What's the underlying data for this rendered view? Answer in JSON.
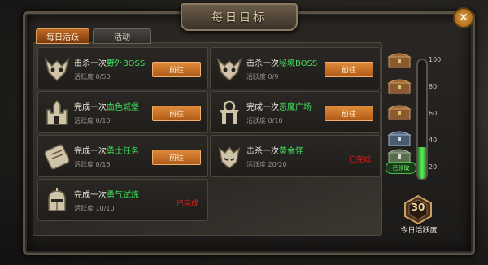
{
  "window": {
    "title": "每日目标"
  },
  "tabs": [
    {
      "label": "每日活跃",
      "active": true
    },
    {
      "label": "活动",
      "active": false
    }
  ],
  "tasks": [
    {
      "prefix": "击杀一次",
      "target": "野外BOSS",
      "progress": "活跃度 0/50",
      "action": "前往",
      "status": "open"
    },
    {
      "prefix": "击杀一次",
      "target": "秘境BOSS",
      "progress": "活跃度 0/9",
      "action": "前往",
      "status": "open"
    },
    {
      "prefix": "完成一次",
      "target": "血色城堡",
      "progress": "活跃度 0/10",
      "action": "前往",
      "status": "open"
    },
    {
      "prefix": "完成一次",
      "target": "恶魔广场",
      "progress": "活跃度 0/10",
      "action": "前往",
      "status": "open"
    },
    {
      "prefix": "完成一次",
      "target": "勇士任务",
      "progress": "活跃度 0/16",
      "action": "前往",
      "status": "open"
    },
    {
      "prefix": "击杀一次",
      "target": "黄金怪",
      "progress": "活跃度 20/20",
      "done_label": "已完成",
      "status": "done"
    },
    {
      "prefix": "完成一次",
      "target": "勇气试炼",
      "progress": "活跃度 10/10",
      "done_label": "已完成",
      "status": "done"
    }
  ],
  "activity": {
    "current": "30",
    "label": "今日活跃度",
    "max": 100,
    "fill_fraction": 0.27,
    "ticks": [
      "100",
      "80",
      "60",
      "40",
      "20"
    ],
    "claimed_label": "已领取"
  },
  "colors": {
    "accent": "#c26a24",
    "highlight": "#3ee05a",
    "done": "#e02020",
    "bar": "#5af05a"
  },
  "icons": [
    "close-icon",
    "demon-skull-icon",
    "castle-icon",
    "scroll-icon",
    "square-gate-icon",
    "gold-monster-icon",
    "knight-helmet-icon",
    "treasure-chest-icon"
  ]
}
